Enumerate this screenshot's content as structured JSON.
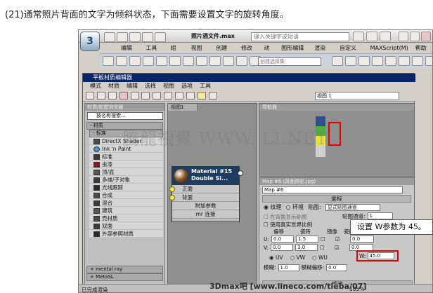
{
  "caption": "(21)通常照片背面的文字为倾斜状态，下面需要设置文字的旋转角度。",
  "app": {
    "title": "照片酒文件.max",
    "search_placeholder": "键入关键字或短语",
    "menu": [
      "编辑(E)",
      "工具(T)",
      "组(G)",
      "视图(V)",
      "创建(C)",
      "修改器",
      "动画",
      "图形编辑器",
      "渲染(R)",
      "自定义(U)",
      "MAXScript(M)",
      "帮助(H)"
    ],
    "selection_set_placeholder": "创建选择集"
  },
  "slate": {
    "title": "平板材质编辑器",
    "menu": [
      "模式",
      "材质",
      "编辑",
      "选择",
      "视图",
      "选项",
      "工具"
    ],
    "view_dropdown": "视图 1",
    "browser": {
      "header": "材质/贴图浏览器",
      "search_placeholder": "按名称搜索...",
      "group_materials": "- 材质",
      "group_standard": "- 标准",
      "items": [
        {
          "label": "DirectX Shader",
          "color": "#4a4a4a"
        },
        {
          "label": "Ink 'n Paint",
          "color": "#4a90d8"
        },
        {
          "label": "标准",
          "color": "#3a3a3a"
        },
        {
          "label": "虫漆",
          "color": "#8a1a1a"
        },
        {
          "label": "顶/底",
          "color": "#555555"
        },
        {
          "label": "多维/子对象",
          "color": "#3a3a3a"
        },
        {
          "label": "光线跟踪",
          "color": "#2a2a2a"
        },
        {
          "label": "合成",
          "color": "#4a4a4a"
        },
        {
          "label": "混合",
          "color": "#3a3a3a"
        },
        {
          "label": "建筑",
          "color": "#5a5a5a"
        },
        {
          "label": "壳材质",
          "color": "#4a4a4a"
        },
        {
          "label": "双面",
          "color": "#3a3a3a"
        },
        {
          "label": "外部参照材质",
          "color": "#2a2a2a"
        }
      ],
      "group_mentalray": "+ mental ray",
      "group_metasl": "+ MetaSL"
    },
    "view_tab": "视图1",
    "node": {
      "title_line1": "Material #15",
      "title_line2": "Double Si...",
      "slot_front": "正面",
      "slot_back": "背面",
      "extra_params": "附加参数",
      "mr_connection": "mr 连接"
    },
    "navigator_label": "导航器",
    "param": {
      "header": "Map #6 (背面顾贴.jpg)",
      "map_name": "Map #6",
      "rollout_coords": "坐标",
      "texture_label": "纹理",
      "environ_label": "环境",
      "mapping_label": "贴图:",
      "mapping_value": "显式贴图通道",
      "show_back": "在背面显示贴图",
      "map_channel_label": "贴图通道:",
      "map_channel_value": "1",
      "real_world": "使用真实世界比例",
      "col_offset": "偏移",
      "col_tiling": "瓷砖",
      "col_mirror": "镜像",
      "col_tile": "瓷砖",
      "col_angle": "角度",
      "u_label": "U:",
      "u_offset": "0.0",
      "u_tiling": "1.5",
      "u_angle": "0.0",
      "v_label": "V:",
      "v_offset": "0.0",
      "v_tiling": "3.0",
      "v_angle": "0.0",
      "w_label": "W:",
      "w_angle": "45.0",
      "uv": "UV",
      "vw": "VW",
      "wu": "WU",
      "blur_label": "模糊:",
      "blur_value": "1.0",
      "blur_offset_label": "模糊偏移:",
      "blur_offset_value": "0.0",
      "rollout_noise": "噪波"
    },
    "status": "已完成渲染",
    "zoom": "105%"
  },
  "callout": "设置 W参数为 45。",
  "watermark": "騰龍視覺 WWW.        LI.NET",
  "footer": "3Dmax吧  [www.lineco.com/tieba/07]"
}
